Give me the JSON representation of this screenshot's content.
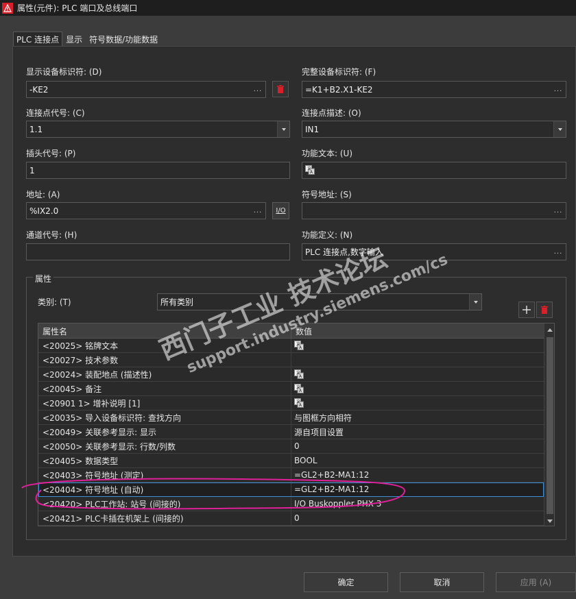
{
  "window": {
    "title": "属性(元件): PLC 端口及总线端口",
    "accent": "#d8202a"
  },
  "tabs": [
    {
      "label": "PLC 连接点",
      "active": true
    },
    {
      "label": "显示",
      "active": false
    },
    {
      "label": "符号数据/功能数据",
      "active": false
    }
  ],
  "fields": {
    "display_dt": {
      "label": "显示设备标识符: (D)",
      "value": "-KE2"
    },
    "full_dt": {
      "label": "完整设备标识符: (F)",
      "value": "=K1+B2.X1-KE2"
    },
    "conn_point": {
      "label": "连接点代号: (C)",
      "value": "1.1"
    },
    "conn_desc": {
      "label": "连接点描述: (O)",
      "value": "IN1"
    },
    "plug": {
      "label": "插头代号: (P)",
      "value": "1"
    },
    "func_text": {
      "label": "功能文本: (U)",
      "value": ""
    },
    "address": {
      "label": "地址: (A)",
      "value": "%IX2.0",
      "io_label": "I/O"
    },
    "sym_address": {
      "label": "符号地址: (S)",
      "value": ""
    },
    "channel": {
      "label": "通道代号: (H)",
      "value": ""
    },
    "func_def": {
      "label": "功能定义: (N)",
      "value": "PLC 连接点,数字输入"
    }
  },
  "properties": {
    "group_title": "属性",
    "category_label": "类别: (T)",
    "category_value": "所有类别",
    "columns": {
      "name": "属性名",
      "value": "数值"
    },
    "rows": [
      {
        "name": "<20025> 铭牌文本",
        "value": "",
        "icon": "translate-icon"
      },
      {
        "name": "<20027> 技术参数",
        "value": ""
      },
      {
        "name": "<20024> 装配地点 (描述性)",
        "value": "",
        "icon": "translate-icon"
      },
      {
        "name": "<20045> 备注",
        "value": "",
        "icon": "translate-icon"
      },
      {
        "name": "<20901 1> 增补说明 [1]",
        "value": "",
        "icon": "translate-icon"
      },
      {
        "name": "<20035> 导入设备标识符: 查找方向",
        "value": "与图框方向相符"
      },
      {
        "name": "<20049> 关联参考显示: 显示",
        "value": "源自项目设置"
      },
      {
        "name": "<20050> 关联参考显示: 行数/列数",
        "value": "0"
      },
      {
        "name": "<20405> 数据类型",
        "value": "BOOL"
      },
      {
        "name": "<20403> 符号地址 (测定)",
        "value": "=GL2+B2-MA1:12"
      },
      {
        "name": "<20404> 符号地址 (自动)",
        "value": "=GL2+B2-MA1:12",
        "selected": true
      },
      {
        "name": "<20420> PLC工作站: 站号 (间接的)",
        "value": "I/O Buskoppler PHX 3"
      },
      {
        "name": "<20421> PLC卡插在机架上 (间接的)",
        "value": "0"
      }
    ]
  },
  "buttons": {
    "ok": "确定",
    "cancel": "取消",
    "apply": "应用 (A)"
  },
  "watermark": {
    "line1": "西门子工业 技术论坛",
    "line2": "support.industry.siemens.com/cs",
    "color": "#ffffff"
  },
  "annotation_color": "#e0209a"
}
